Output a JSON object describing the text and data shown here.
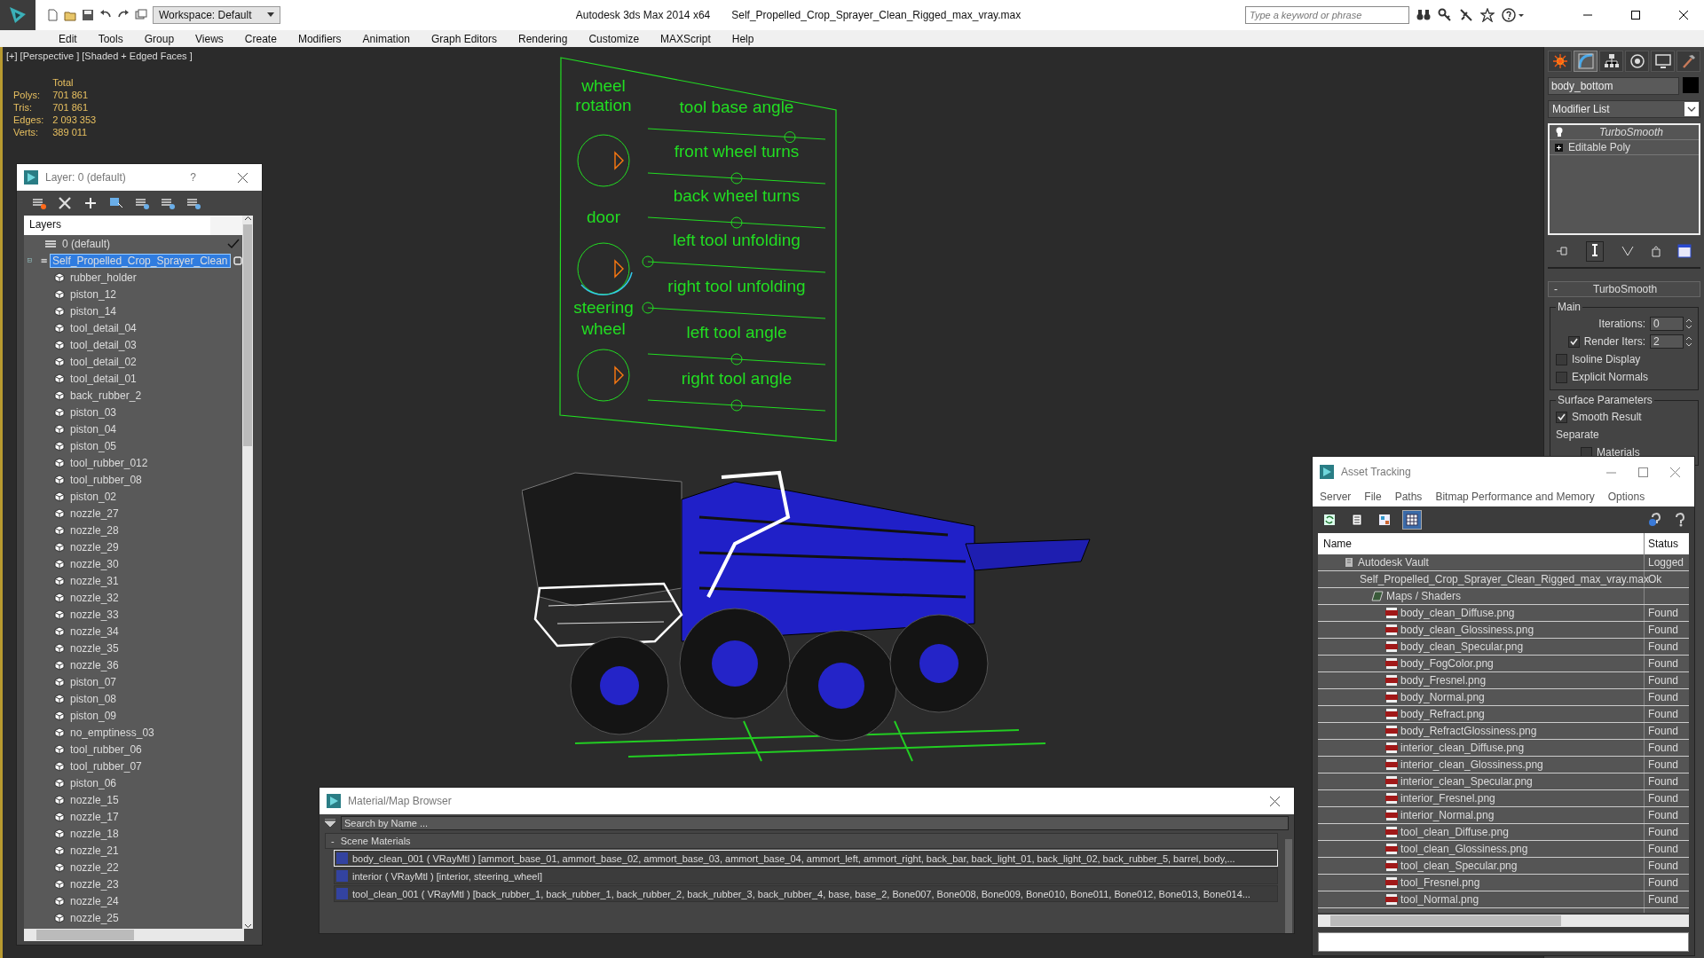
{
  "title_bar": {
    "workspace": "Workspace: Default",
    "app_title": "Autodesk 3ds Max  2014 x64",
    "file_name": "Self_Propelled_Crop_Sprayer_Clean_Rigged_max_vray.max",
    "search_placeholder": "Type a keyword or phrase"
  },
  "menu": [
    "Edit",
    "Tools",
    "Group",
    "Views",
    "Create",
    "Modifiers",
    "Animation",
    "Graph Editors",
    "Rendering",
    "Customize",
    "MAXScript",
    "Help"
  ],
  "viewport": {
    "label": "[+] [Perspective ] [Shaded + Edged Faces ]",
    "stats": {
      "header": "Total",
      "rows": [
        {
          "label": "Polys:",
          "value": "701 861"
        },
        {
          "label": "Tris:",
          "value": "701 861"
        },
        {
          "label": "Edges:",
          "value": "2 093 353"
        },
        {
          "label": "Verts:",
          "value": "389 011"
        }
      ]
    },
    "rig_panel": {
      "dials": [
        {
          "lines": [
            "wheel",
            "rotation"
          ],
          "open_arc": false
        },
        {
          "lines": [
            "door"
          ],
          "open_arc": true
        },
        {
          "lines": [
            "steering",
            "wheel"
          ],
          "open_arc": false
        }
      ],
      "sliders": [
        {
          "label": "tool base angle",
          "level": 0.8
        },
        {
          "label": "front wheel turns",
          "level": 0.5
        },
        {
          "label": "back wheel turns",
          "level": 0.5
        },
        {
          "label": "left tool unfolding",
          "level": 0
        },
        {
          "label": "right tool unfolding",
          "level": 0
        },
        {
          "label": "left tool angle",
          "level": 0.5
        },
        {
          "label": "right tool angle",
          "level": 0.5
        }
      ]
    }
  },
  "layer_window": {
    "title": "Layer: 0 (default)",
    "help": "?",
    "header": "Layers",
    "layers": [
      {
        "name": "0 (default)",
        "current": true,
        "selected": false,
        "expanded": false
      },
      {
        "name": "Self_Propelled_Crop_Sprayer_Clean",
        "current": false,
        "selected": true,
        "expanded": true,
        "children": [
          "rubber_holder",
          "piston_12",
          "piston_14",
          "tool_detail_04",
          "tool_detail_03",
          "tool_detail_02",
          "tool_detail_01",
          "back_rubber_2",
          "piston_03",
          "piston_04",
          "piston_05",
          "tool_rubber_012",
          "tool_rubber_08",
          "piston_02",
          "nozzle_27",
          "nozzle_28",
          "nozzle_29",
          "nozzle_30",
          "nozzle_31",
          "nozzle_32",
          "nozzle_33",
          "nozzle_34",
          "nozzle_35",
          "nozzle_36",
          "piston_07",
          "piston_08",
          "piston_09",
          "no_emptiness_03",
          "tool_rubber_06",
          "tool_rubber_07",
          "piston_06",
          "nozzle_15",
          "nozzle_17",
          "nozzle_18",
          "nozzle_21",
          "nozzle_22",
          "nozzle_23",
          "nozzle_24",
          "nozzle_25"
        ]
      }
    ]
  },
  "command_panel": {
    "tabs": [
      {
        "kind": "create",
        "selected": false
      },
      {
        "kind": "modify",
        "selected": true
      },
      {
        "kind": "hierarchy",
        "selected": false
      },
      {
        "kind": "motion",
        "selected": false
      },
      {
        "kind": "display",
        "selected": false
      },
      {
        "kind": "utilities",
        "selected": false
      }
    ],
    "object_name": "body_bottom",
    "modifier_list": "Modifier List",
    "stack": [
      {
        "name": "TurboSmooth",
        "kind": "modifier"
      },
      {
        "name": "Editable Poly",
        "kind": "base"
      }
    ],
    "rollout": {
      "title": "TurboSmooth",
      "collapse": "-",
      "main_group": "Main",
      "iterations": {
        "label": "Iterations:",
        "value": "0"
      },
      "render_iters": {
        "label": "Render Iters:",
        "value": "2",
        "checked": true
      },
      "options": [
        {
          "label": "Isoline Display",
          "checked": false
        },
        {
          "label": "Explicit Normals",
          "checked": false
        }
      ],
      "surface_group": "Surface Parameters",
      "smooth_result": {
        "label": "Smooth Result",
        "checked": true
      },
      "separate": "Separate",
      "materials": {
        "label": "Materials",
        "checked": false
      }
    }
  },
  "material_browser": {
    "title": "Material/Map Browser",
    "search_placeholder": "Search by Name ...",
    "section": "Scene Materials",
    "section_toggle": "-",
    "materials": [
      {
        "text": "body_clean_001  ( VRayMtl )  [ammort_base_01, ammort_base_02, ammort_base_03, ammort_base_04, ammort_left, ammort_right, back_bar, back_light_01, back_light_02, back_rubber_5, barrel, body,...",
        "selected": true
      },
      {
        "text": "interior  ( VRayMtl )  [interior, steering_wheel]",
        "selected": false
      },
      {
        "text": "tool_clean_001  ( VRayMtl )  [back_rubber_1, back_rubber_1, back_rubber_2, back_rubber_3, back_rubber_4, base, base_2, Bone007, Bone008, Bone009, Bone010, Bone011, Bone012, Bone013, Bone014...",
        "selected": false
      }
    ]
  },
  "asset_tracking": {
    "title": "Asset Tracking",
    "menu": [
      "Server",
      "File",
      "Paths",
      "Bitmap Performance and Memory",
      "Options"
    ],
    "toolbar": [
      {
        "selected": false
      },
      {
        "selected": false
      },
      {
        "selected": false
      },
      {
        "selected": true
      }
    ],
    "columns": [
      "Name",
      "Status"
    ],
    "tree": [
      {
        "name": "Autodesk Vault",
        "status": "Logged",
        "kind": "vault",
        "children": [
          {
            "name": "Self_Propelled_Crop_Sprayer_Clean_Rigged_max_vray.max",
            "status": "Ok",
            "kind": "max",
            "children": [
              {
                "name": "Maps / Shaders",
                "kind": "folder",
                "children": [
                  {
                    "name": "body_clean_Diffuse.png",
                    "status": "Found",
                    "kind": "png"
                  },
                  {
                    "name": "body_clean_Glossiness.png",
                    "status": "Found",
                    "kind": "png"
                  },
                  {
                    "name": "body_clean_Specular.png",
                    "status": "Found",
                    "kind": "png"
                  },
                  {
                    "name": "body_FogColor.png",
                    "status": "Found",
                    "kind": "png"
                  },
                  {
                    "name": "body_Fresnel.png",
                    "status": "Found",
                    "kind": "png"
                  },
                  {
                    "name": "body_Normal.png",
                    "status": "Found",
                    "kind": "png"
                  },
                  {
                    "name": "body_Refract.png",
                    "status": "Found",
                    "kind": "png"
                  },
                  {
                    "name": "body_RefractGlossiness.png",
                    "status": "Found",
                    "kind": "png"
                  },
                  {
                    "name": "interior_clean_Diffuse.png",
                    "status": "Found",
                    "kind": "png"
                  },
                  {
                    "name": "interior_clean_Glossiness.png",
                    "status": "Found",
                    "kind": "png"
                  },
                  {
                    "name": "interior_clean_Specular.png",
                    "status": "Found",
                    "kind": "png"
                  },
                  {
                    "name": "interior_Fresnel.png",
                    "status": "Found",
                    "kind": "png"
                  },
                  {
                    "name": "interior_Normal.png",
                    "status": "Found",
                    "kind": "png"
                  },
                  {
                    "name": "tool_clean_Diffuse.png",
                    "status": "Found",
                    "kind": "png"
                  },
                  {
                    "name": "tool_clean_Glossiness.png",
                    "status": "Found",
                    "kind": "png"
                  },
                  {
                    "name": "tool_clean_Specular.png",
                    "status": "Found",
                    "kind": "png"
                  },
                  {
                    "name": "tool_Fresnel.png",
                    "status": "Found",
                    "kind": "png"
                  },
                  {
                    "name": "tool_Normal.png",
                    "status": "Found",
                    "kind": "png"
                  }
                ]
              }
            ]
          }
        ]
      }
    ]
  }
}
